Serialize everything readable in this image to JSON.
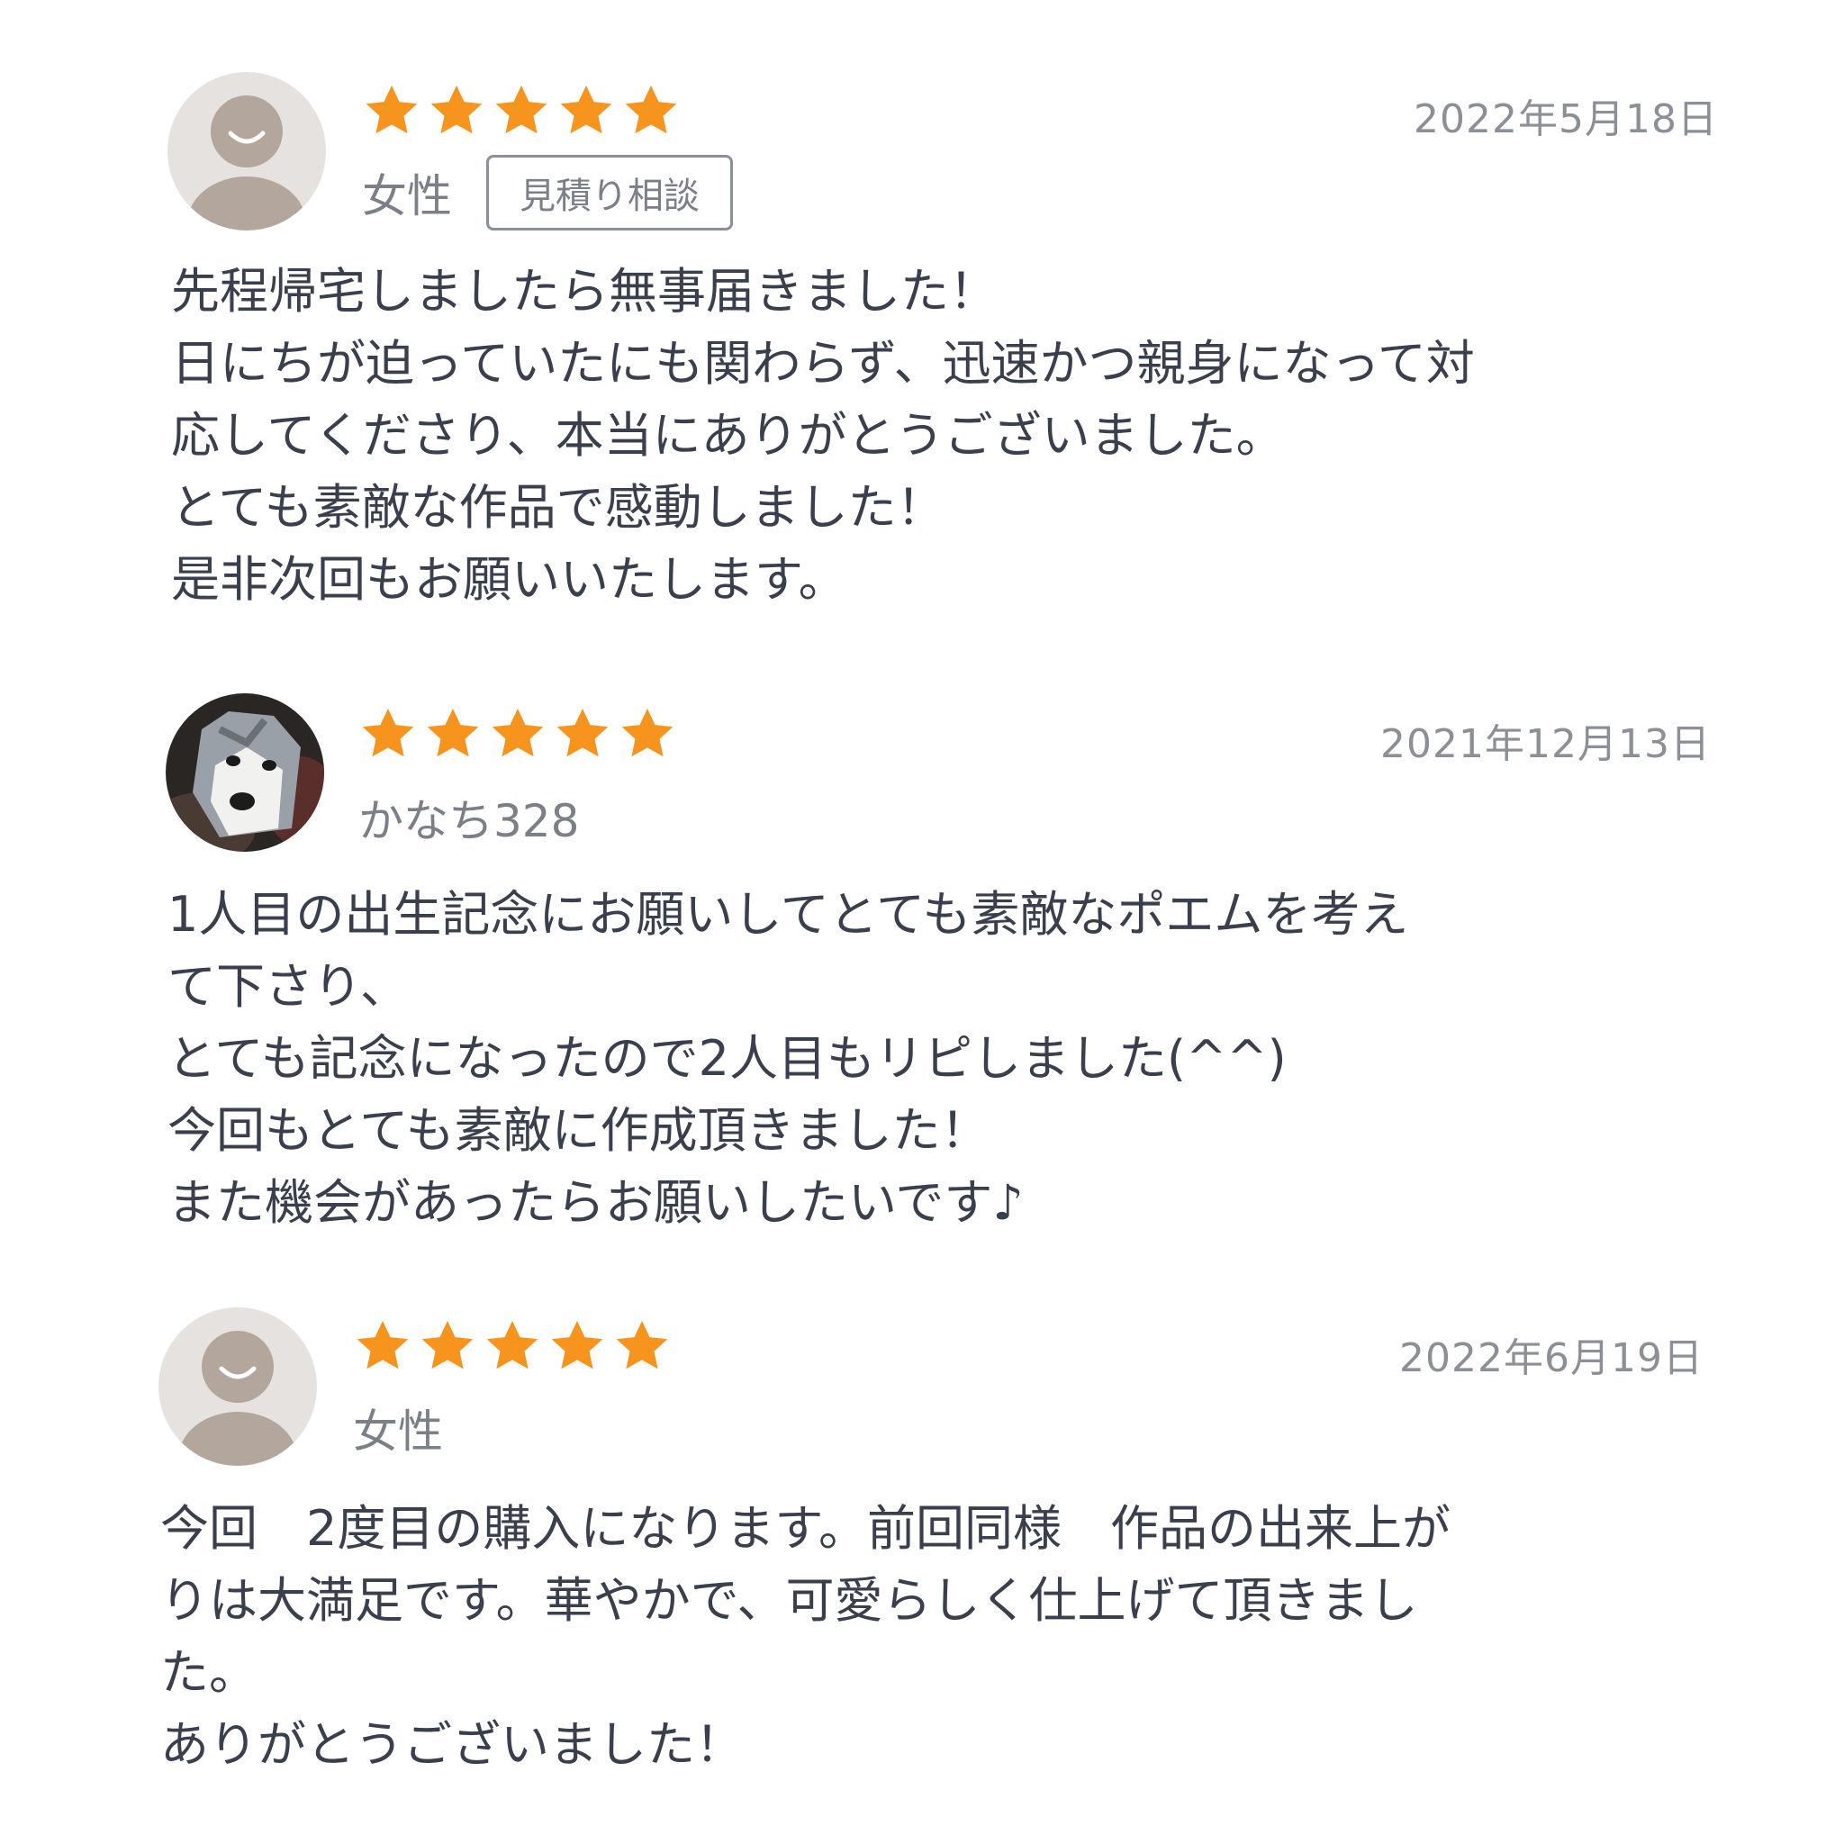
{
  "colors": {
    "star": "#f7941d",
    "default_avatar_bg": "#e6e2df",
    "default_avatar_figure": "#b3a69c",
    "text_primary": "#3a3f4d",
    "text_secondary": "#8c8f96"
  },
  "reviews": [
    {
      "rating": 5,
      "avatar_icon": "default-user-icon",
      "username": "女性",
      "tag": "見積り相談",
      "date": "2022年5月18日",
      "body": "先程帰宅しましたら無事届きました！\n日にちが迫っていたにも関わらず、迅速かつ親身になって対\n応してくださり、本当にありがとうございました。\nとても素敵な作品で感動しました！\n是非次回もお願いいたします。"
    },
    {
      "rating": 5,
      "avatar_icon": "dog-photo-avatar",
      "username": "かなち328",
      "tag": "",
      "date": "2021年12月13日",
      "body": "1人目の出生記念にお願いしてとても素敵なポエムを考え\nて下さり、\nとても記念になったので2人目もリピしました(^^)\n今回もとても素敵に作成頂きました！\nまた機会があったらお願いしたいです♪"
    },
    {
      "rating": 5,
      "avatar_icon": "default-user-icon",
      "username": "女性",
      "tag": "",
      "date": "2022年6月19日",
      "body": "今回　2度目の購入になります。前回同様　作品の出来上が\nりは大満足です。華やかで、可愛らしく仕上げて頂きまし\nた。\nありがとうございました！"
    }
  ]
}
